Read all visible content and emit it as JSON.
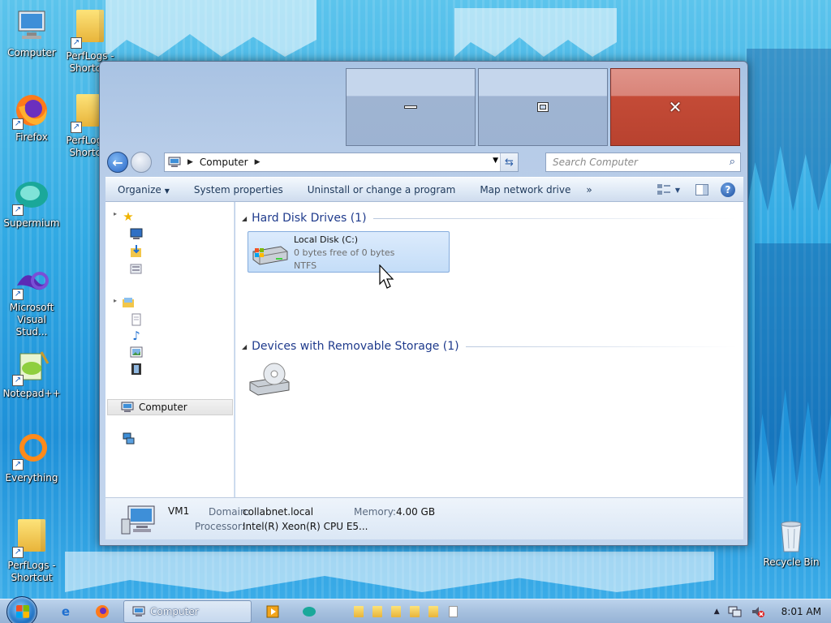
{
  "desktop": {
    "icons": [
      {
        "label": "Computer",
        "name": "computer-desktop-icon"
      },
      {
        "label": "PerfLogs - Shortcut",
        "name": "perflogs-shortcut-1"
      },
      {
        "label": "Firefox",
        "name": "firefox-desktop-icon"
      },
      {
        "label": "PerfLogs - Shortcut",
        "name": "perflogs-shortcut-2"
      },
      {
        "label": "Supermium",
        "name": "supermium-desktop-icon"
      },
      {
        "label": "Microsoft Visual Stud...",
        "name": "visual-studio-desktop-icon"
      },
      {
        "label": "Notepad++",
        "name": "notepadpp-desktop-icon"
      },
      {
        "label": "Everything",
        "name": "everything-desktop-icon"
      },
      {
        "label": "PerfLogs - Shortcut",
        "name": "perflogs-shortcut-3"
      },
      {
        "label": "Recycle Bin",
        "name": "recycle-bin-desktop-icon"
      }
    ]
  },
  "window": {
    "address": {
      "crumb": "Computer"
    },
    "search": {
      "placeholder": "Search Computer"
    },
    "toolbar": {
      "organize": "Organize",
      "system_properties": "System properties",
      "uninstall": "Uninstall or change a program",
      "map_drive": "Map network drive",
      "more": "»"
    },
    "nav": {
      "selected": "Computer"
    },
    "groups": {
      "hard_disk": "Hard Disk Drives (1)",
      "removable": "Devices with Removable Storage (1)"
    },
    "drive": {
      "name": "Local Disk (C:)",
      "free": "0 bytes free of 0 bytes",
      "fs": "NTFS"
    },
    "details": {
      "computer_name": "VM1",
      "domain_label": "Domain:",
      "domain_value": "collabnet.local",
      "memory_label": "Memory:",
      "memory_value": "4.00 GB",
      "processor_label": "Processor:",
      "processor_value": "Intel(R) Xeon(R) CPU E5..."
    }
  },
  "taskbar": {
    "active_task": "Computer",
    "clock": "8:01 AM"
  },
  "colors": {
    "desktop": "#2fa8e3",
    "close_button": "#c44b37",
    "group_header": "#1e3a8c"
  }
}
